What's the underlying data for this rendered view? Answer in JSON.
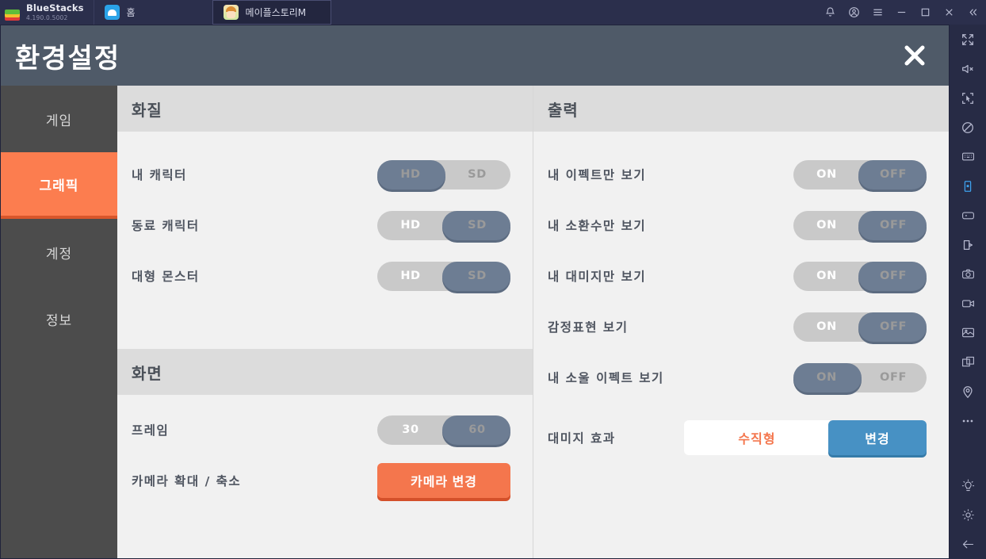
{
  "titlebar": {
    "brand_name": "BlueStacks",
    "brand_version": "4.190.0.5002",
    "tabs": [
      {
        "label": "홈",
        "icon": "home-icon",
        "active": false
      },
      {
        "label": "메이플스토리M",
        "icon": "maplestory-app-icon",
        "active": true
      }
    ],
    "icons": [
      {
        "name": "bell-icon"
      },
      {
        "name": "account-icon"
      },
      {
        "name": "hamburger-menu-icon"
      },
      {
        "name": "minimize-icon"
      },
      {
        "name": "maximize-icon"
      },
      {
        "name": "close-icon"
      },
      {
        "name": "collapse-icon"
      }
    ]
  },
  "right_toolbar": {
    "icons": [
      "fullscreen-icon",
      "mute-icon",
      "cursor-select-icon",
      "adblock-icon",
      "keyboard-icon",
      "device-icon",
      "gamepad-icon",
      "macro-icon",
      "camera-icon",
      "video-record-icon",
      "gallery-icon",
      "multi-instance-icon",
      "location-icon",
      "more-icon",
      "tips-icon",
      "settings-gear-icon",
      "back-arrow-icon"
    ],
    "selected_icon": "device-icon"
  },
  "app": {
    "title": "환경설정",
    "close_label": "×",
    "accent_orange": "#fc7d4f",
    "accent_blue": "#4791c4",
    "toggle_active_color": "#6d7d93"
  },
  "nav": {
    "items": [
      {
        "label": "게임",
        "active": false
      },
      {
        "label": "그래픽",
        "active": true
      },
      {
        "label": "계정",
        "active": false
      },
      {
        "label": "정보",
        "active": false
      }
    ]
  },
  "left_pane": {
    "sections": [
      {
        "title": "화질",
        "rows": [
          {
            "label": "내 캐릭터",
            "type": "toggle",
            "options": [
              "HD",
              "SD"
            ],
            "selected": "HD"
          },
          {
            "label": "동료 캐릭터",
            "type": "toggle",
            "options": [
              "HD",
              "SD"
            ],
            "selected": "SD"
          },
          {
            "label": "대형 몬스터",
            "type": "toggle",
            "options": [
              "HD",
              "SD"
            ],
            "selected": "SD"
          }
        ]
      },
      {
        "title": "화면",
        "rows": [
          {
            "label": "프레임",
            "type": "toggle",
            "options": [
              "30",
              "60"
            ],
            "selected": "60"
          },
          {
            "label": "카메라 확대 / 축소",
            "type": "button",
            "button_label": "카메라 변경"
          }
        ]
      }
    ]
  },
  "right_pane": {
    "sections": [
      {
        "title": "출력",
        "rows": [
          {
            "label": "내 이펙트만 보기",
            "type": "toggle",
            "options": [
              "ON",
              "OFF"
            ],
            "selected": "OFF"
          },
          {
            "label": "내 소환수만 보기",
            "type": "toggle",
            "options": [
              "ON",
              "OFF"
            ],
            "selected": "OFF"
          },
          {
            "label": "내 대미지만 보기",
            "type": "toggle",
            "options": [
              "ON",
              "OFF"
            ],
            "selected": "OFF"
          },
          {
            "label": "감정표현 보기",
            "type": "toggle",
            "options": [
              "ON",
              "OFF"
            ],
            "selected": "OFF"
          },
          {
            "label": "내 소울 이펙트 보기",
            "type": "toggle",
            "options": [
              "ON",
              "OFF"
            ],
            "selected": "ON"
          },
          {
            "label": "대미지 효과",
            "type": "value",
            "value": "수직형",
            "button_label": "변경"
          }
        ]
      }
    ]
  }
}
